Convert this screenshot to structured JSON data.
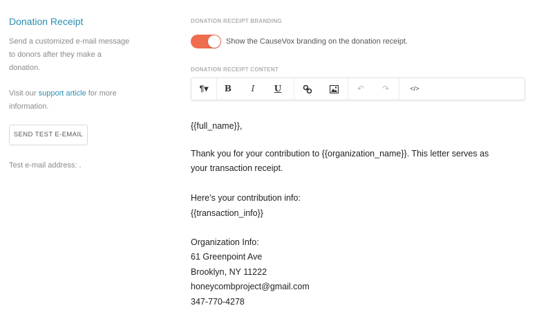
{
  "sidebar": {
    "title": "Donation Receipt",
    "description": "Send a customized e-mail message to donors after they make a donation.",
    "visit_prefix": "Visit our ",
    "support_link": "support article",
    "visit_suffix": " for more information.",
    "test_button": "SEND TEST E-EMAIL",
    "test_address": "Test e-mail address: ."
  },
  "branding": {
    "caption": "DONATION RECEIPT BRANDING",
    "toggle_on": true,
    "toggle_label": "Show the CauseVox branding on the donation receipt.",
    "toggle_color": "#ef6c4e"
  },
  "content": {
    "caption": "DONATION RECEIPT CONTENT",
    "toolbar": {
      "paragraph": "¶▾",
      "bold": "B",
      "italic": "I",
      "underline": "U",
      "link_icon": "link-icon",
      "image_icon": "image-icon",
      "undo_icon": "undo-icon",
      "redo_icon": "redo-icon",
      "code": "</>"
    },
    "lines": {
      "greeting": "{{full_name}},",
      "thanks1": "Thank you for your contribution to {{organization_name}}. This letter serves as",
      "thanks2": "your transaction receipt.",
      "info_label": "Here’s your contribution info:",
      "info_var": "{{transaction_info}}",
      "org_label": "Organization Info:",
      "street": "61 Greenpoint Ave",
      "city": "Brooklyn, NY 11222",
      "email": "honeycombproject@gmail.com",
      "phone": "347-770-4278"
    }
  }
}
